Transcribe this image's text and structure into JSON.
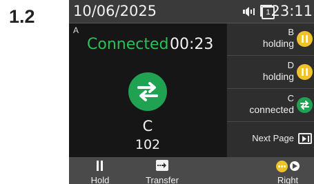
{
  "step_label": "1.2",
  "status_bar": {
    "date": "10/06/2025",
    "time": "23:11",
    "line_count": "1",
    "icons": [
      "speaker-icon",
      "lines-icon"
    ]
  },
  "active_call": {
    "line": "A",
    "status": "Connected",
    "timer": "00:23",
    "icon": "transfer-arrows-icon",
    "name": "C",
    "number": "102",
    "status_color": "#2cbf5a"
  },
  "lines": [
    {
      "id": "B",
      "state": "holding",
      "icon": "hold-icon"
    },
    {
      "id": "D",
      "state": "holding",
      "icon": "hold-icon"
    },
    {
      "id": "C",
      "state": "connected",
      "icon": "connected-arrows-icon"
    }
  ],
  "next_page": {
    "label": "Next Page",
    "icon": "next-page-icon"
  },
  "softkeys": {
    "hold": "Hold",
    "transfer": "Transfer",
    "right": "Right"
  },
  "colors": {
    "green": "#1fa352",
    "yellow": "#f0c22a"
  }
}
